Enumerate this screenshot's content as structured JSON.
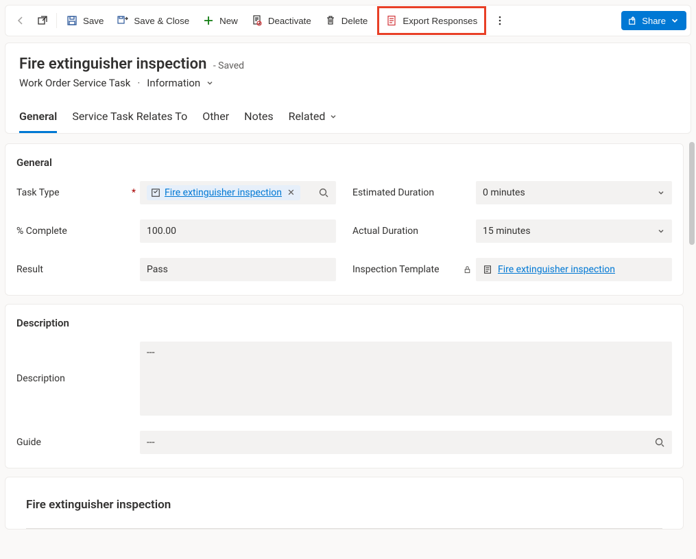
{
  "toolbar": {
    "save": "Save",
    "save_close": "Save & Close",
    "new": "New",
    "deactivate": "Deactivate",
    "delete": "Delete",
    "export_responses": "Export Responses",
    "share": "Share"
  },
  "header": {
    "title": "Fire extinguisher inspection",
    "saved_suffix": "- Saved",
    "entity": "Work Order Service Task",
    "form": "Information"
  },
  "tabs": {
    "general": "General",
    "relates": "Service Task Relates To",
    "other": "Other",
    "notes": "Notes",
    "related": "Related"
  },
  "sections": {
    "general_title": "General",
    "description_title": "Description"
  },
  "fields": {
    "task_type": {
      "label": "Task Type",
      "value": "Fire extinguisher inspection"
    },
    "percent_complete": {
      "label": "% Complete",
      "value": "100.00"
    },
    "result": {
      "label": "Result",
      "value": "Pass"
    },
    "est_duration": {
      "label": "Estimated Duration",
      "value": "0 minutes"
    },
    "act_duration": {
      "label": "Actual Duration",
      "value": "15 minutes"
    },
    "inspection_template": {
      "label": "Inspection Template",
      "value": "Fire extinguisher inspection"
    },
    "description": {
      "label": "Description",
      "value": "---"
    },
    "guide": {
      "label": "Guide",
      "value": "---"
    }
  },
  "embedded": {
    "title": "Fire extinguisher inspection"
  }
}
